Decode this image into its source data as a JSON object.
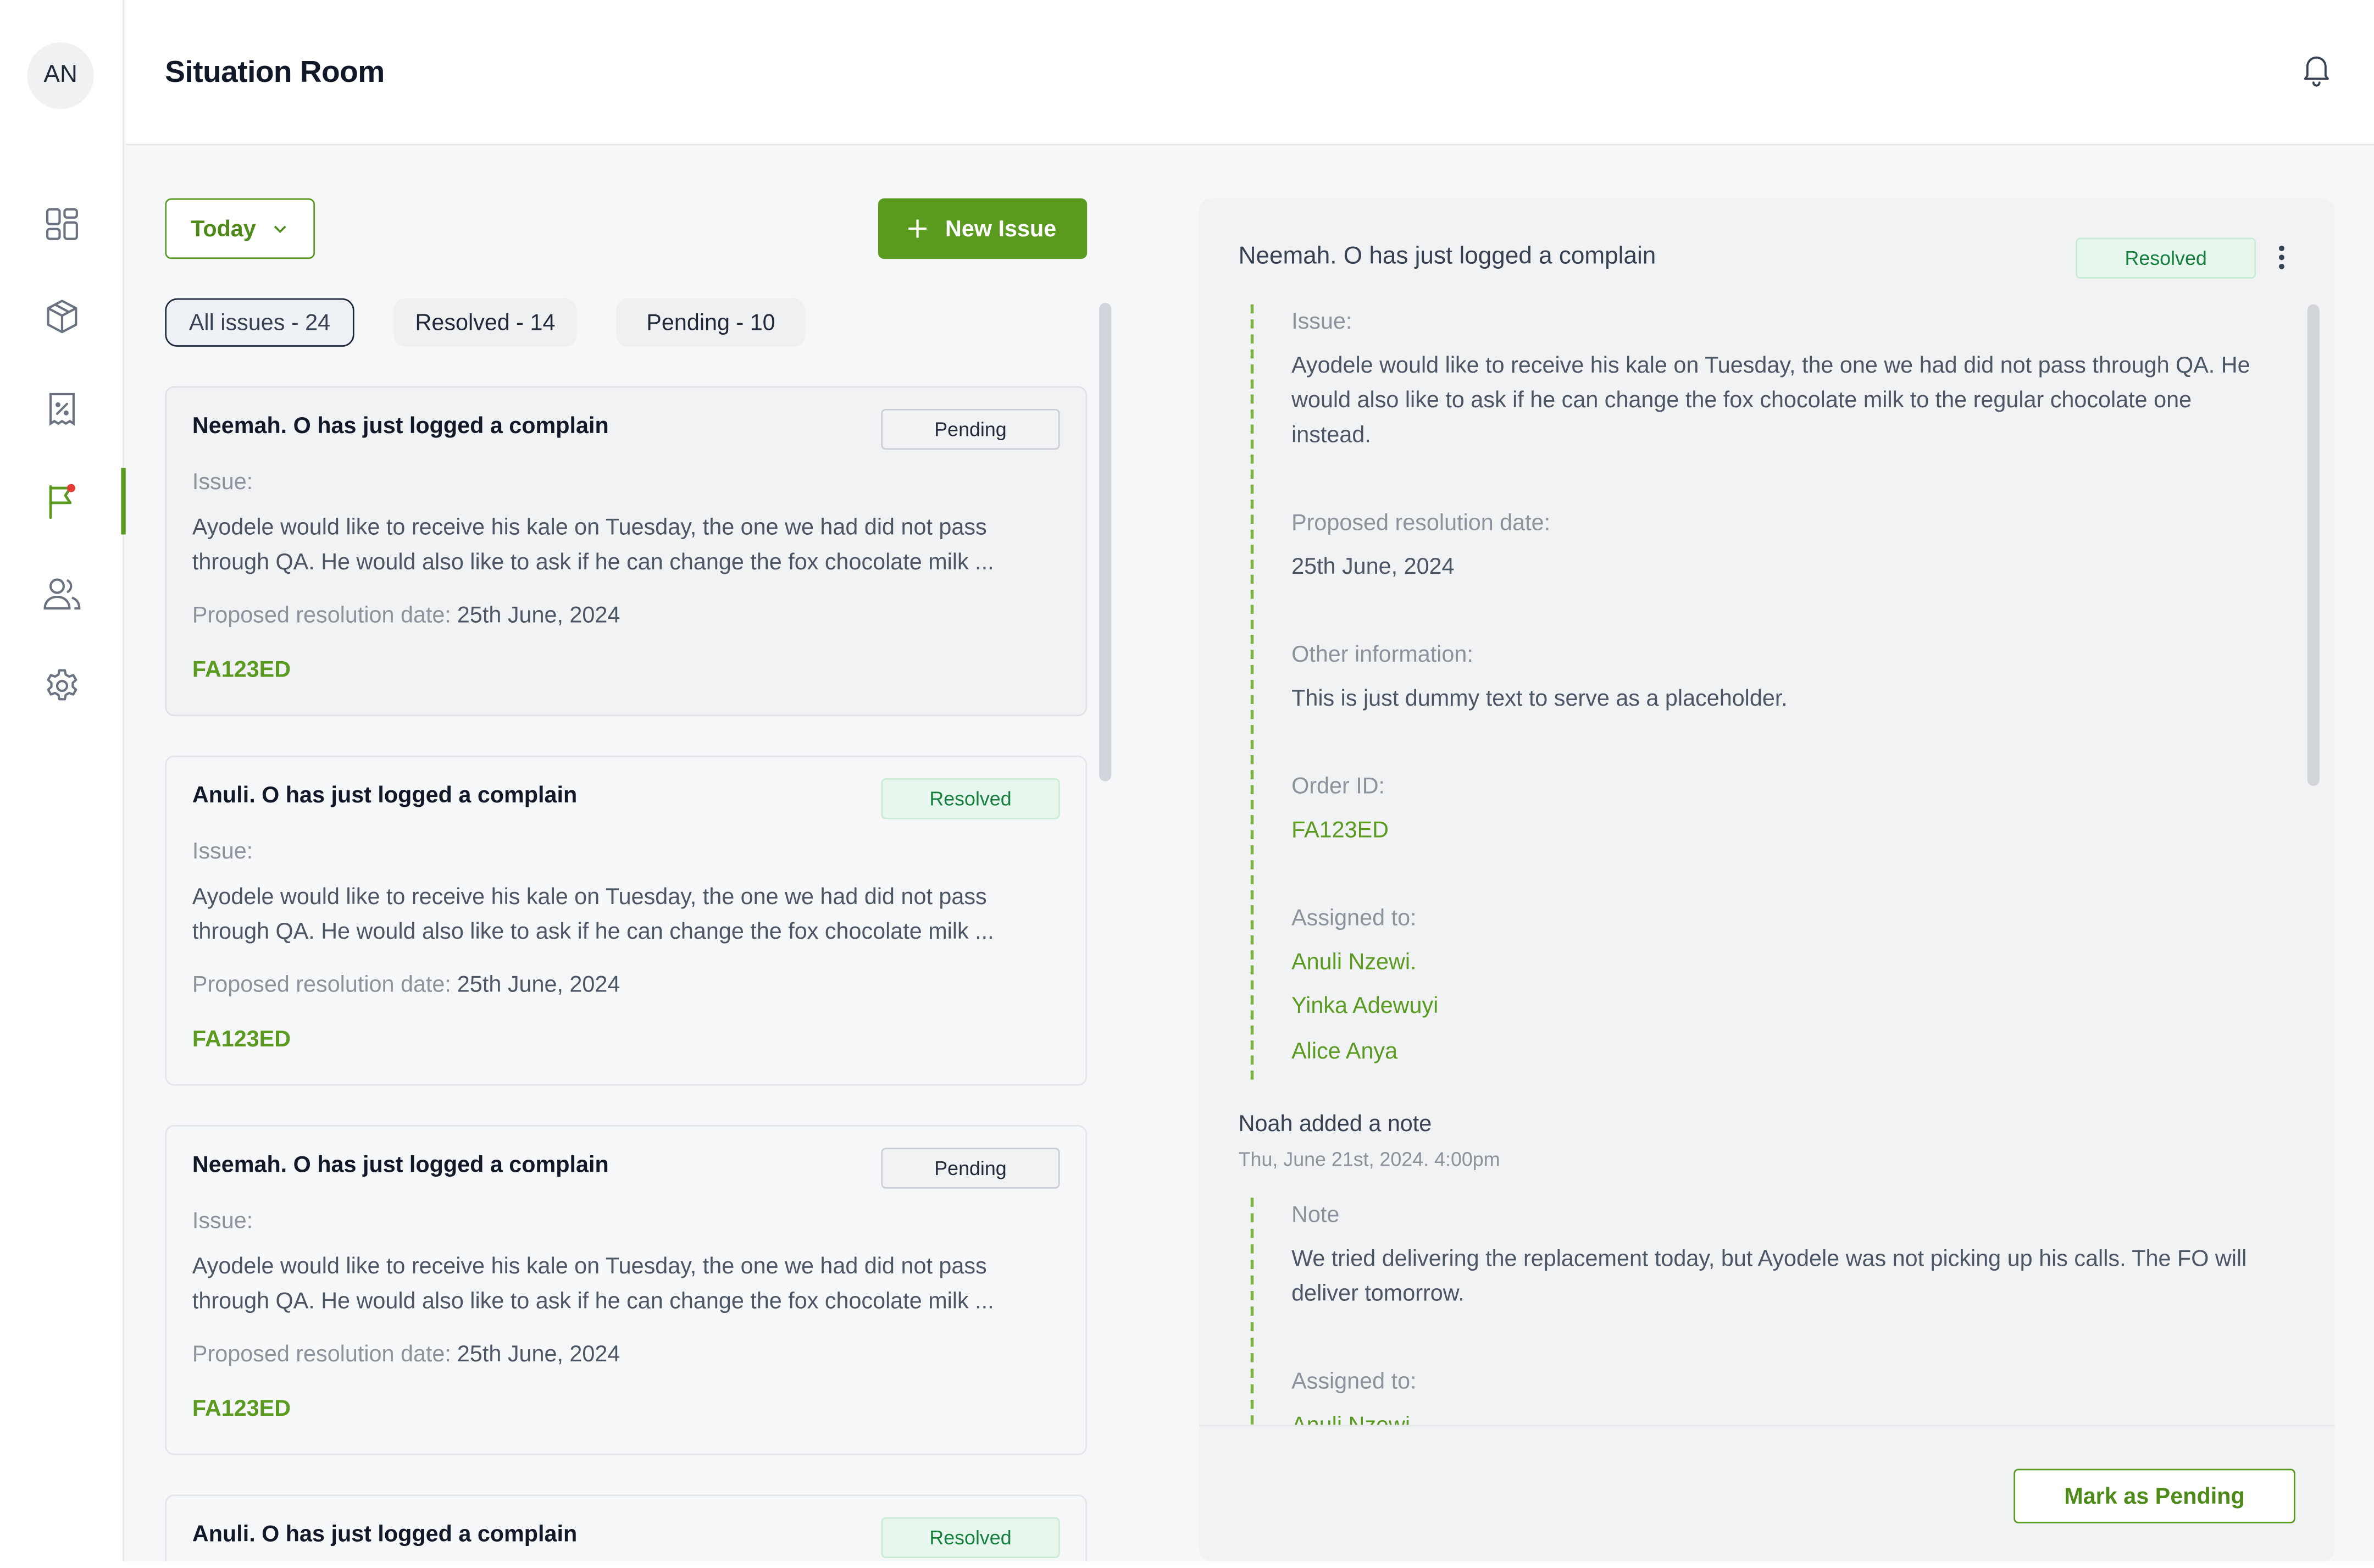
{
  "header": {
    "title": "Situation Room",
    "avatar_initials": "AN"
  },
  "sidebar": {
    "items": [
      {
        "name": "dashboard-icon"
      },
      {
        "name": "package-icon"
      },
      {
        "name": "discount-icon"
      },
      {
        "name": "flag-icon",
        "active": true
      },
      {
        "name": "users-icon"
      },
      {
        "name": "settings-icon"
      }
    ]
  },
  "toolbar": {
    "date_filter": "Today",
    "new_issue_label": "New Issue"
  },
  "filters": {
    "all": "All issues - 24",
    "resolved": "Resolved - 14",
    "pending": "Pending - 10"
  },
  "issues": [
    {
      "title": "Neemah. O has just logged a complain",
      "status": "Pending",
      "issue_label": "Issue:",
      "issue_text": "Ayodele would like to receive his kale on Tuesday, the one we had did not pass through QA. He would also like to ask if he can change the fox chocolate milk ...",
      "date_label": "Proposed resolution date:",
      "date_value": "25th June, 2024",
      "order_id": "FA123ED"
    },
    {
      "title": "Anuli. O has just logged a complain",
      "status": "Resolved",
      "issue_label": "Issue:",
      "issue_text": "Ayodele would like to receive his kale on Tuesday, the one we had did not pass through QA. He would also like to ask if he can change the fox chocolate milk ...",
      "date_label": "Proposed resolution date:",
      "date_value": "25th June, 2024",
      "order_id": "FA123ED"
    },
    {
      "title": "Neemah. O has just logged a complain",
      "status": "Pending",
      "issue_label": "Issue:",
      "issue_text": "Ayodele would like to receive his kale on Tuesday, the one we had did not pass through QA. He would also like to ask if he can change the fox chocolate milk ...",
      "date_label": "Proposed resolution date:",
      "date_value": "25th June, 2024",
      "order_id": "FA123ED"
    },
    {
      "title": "Anuli. O has just logged a complain",
      "status": "Resolved"
    }
  ],
  "detail": {
    "title": "Neemah. O has just logged a complain",
    "status": "Resolved",
    "issue_label": "Issue:",
    "issue_text": "Ayodele would like to receive his kale on Tuesday, the one we had did not pass through QA. He would also like to ask if he can change the fox chocolate milk to the regular chocolate one instead.",
    "date_label": "Proposed resolution date:",
    "date_value": "25th June, 2024",
    "other_label": "Other information:",
    "other_value": "This is just dummy text to serve as a placeholder.",
    "order_label": "Order ID:",
    "order_value": "FA123ED",
    "assigned_label": "Assigned to:",
    "assigned": [
      "Anuli Nzewi.",
      "Yinka Adewuyi",
      "Alice Anya"
    ],
    "note": {
      "author": "Noah added a note",
      "time": "Thu, June 21st, 2024. 4:00pm",
      "label": "Note",
      "text": "We tried delivering the replacement today, but Ayodele was not picking up his calls. The FO will deliver tomorrow.",
      "assigned_label": "Assigned to:",
      "assigned_first": "Anuli Nzewi."
    },
    "action_label": "Mark as Pending"
  }
}
